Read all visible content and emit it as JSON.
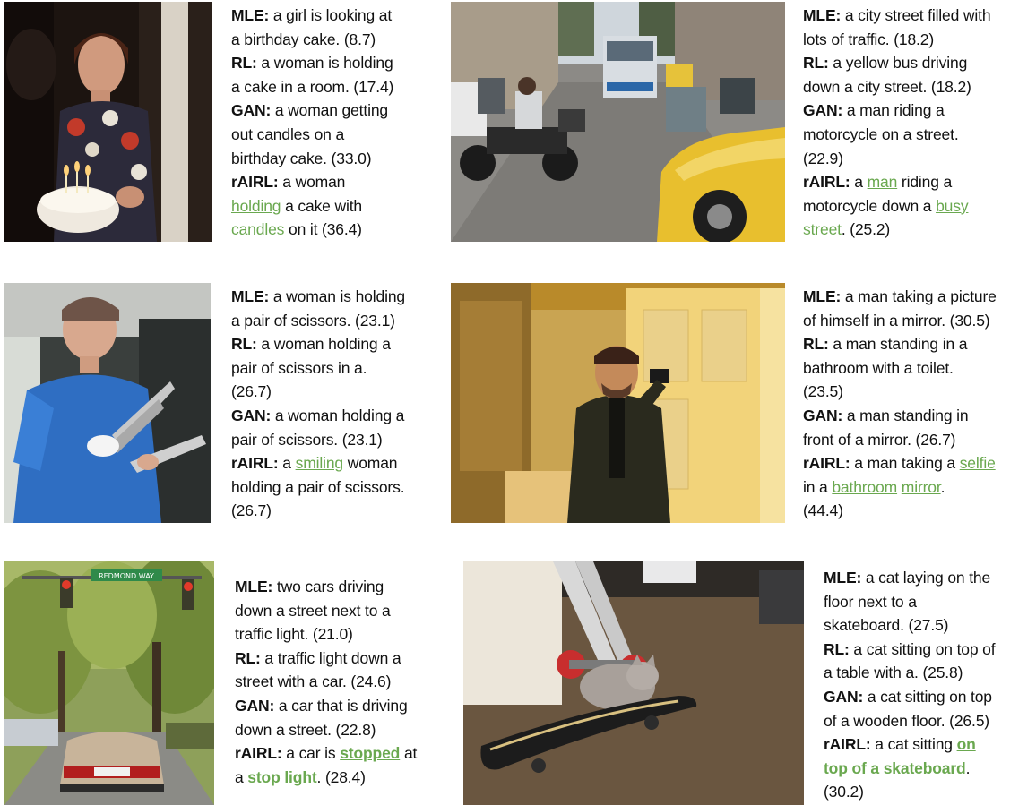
{
  "figures": [
    {
      "image": "woman-birthday-cake-photo",
      "lines": [
        [
          {
            "t": "MLE:",
            "s": "b"
          },
          {
            "t": " a girl is looking at"
          }
        ],
        [
          {
            "t": "a birthday cake. (8.7)"
          }
        ],
        [
          {
            "t": "RL:",
            "s": "b"
          },
          {
            "t": " a woman is holding"
          }
        ],
        [
          {
            "t": "a cake in a room. (17.4)"
          }
        ],
        [
          {
            "t": "GAN:",
            "s": "b"
          },
          {
            "t": " a woman getting"
          }
        ],
        [
          {
            "t": "out candles on a"
          }
        ],
        [
          {
            "t": "birthday cake. (33.0)"
          }
        ],
        [
          {
            "t": "rAIRL:",
            "s": "b"
          },
          {
            "t": " a woman"
          }
        ],
        [
          {
            "t": "holding",
            "s": "h"
          },
          {
            "t": " a cake with"
          }
        ],
        [
          {
            "t": "candles",
            "s": "h"
          },
          {
            "t": " on it (36.4)"
          }
        ]
      ]
    },
    {
      "image": "city-street-traffic-motorcycle-photo",
      "lines": [
        [
          {
            "t": "MLE:",
            "s": "b"
          },
          {
            "t": " a city street filled with"
          }
        ],
        [
          {
            "t": "lots of traffic. (18.2)"
          }
        ],
        [
          {
            "t": "RL:",
            "s": "b"
          },
          {
            "t": " a yellow bus driving"
          }
        ],
        [
          {
            "t": "down a city street. (18.2)"
          }
        ],
        [
          {
            "t": "GAN:",
            "s": "b"
          },
          {
            "t": " a man riding a"
          }
        ],
        [
          {
            "t": "motorcycle on a street."
          }
        ],
        [
          {
            "t": "(22.9)"
          }
        ],
        [
          {
            "t": "rAIRL:",
            "s": "b"
          },
          {
            "t": " a "
          },
          {
            "t": "man",
            "s": "h"
          },
          {
            "t": " riding a"
          }
        ],
        [
          {
            "t": "motorcycle down a "
          },
          {
            "t": "busy",
            "s": "h"
          }
        ],
        [
          {
            "t": "street",
            "s": "h"
          },
          {
            "t": ". (25.2)"
          }
        ]
      ]
    },
    {
      "image": "woman-holding-scissors-photo",
      "lines": [
        [
          {
            "t": "MLE:",
            "s": "b"
          },
          {
            "t": " a woman is holding"
          }
        ],
        [
          {
            "t": "a pair of scissors. (23.1)"
          }
        ],
        [
          {
            "t": "RL:",
            "s": "b"
          },
          {
            "t": " a woman holding a"
          }
        ],
        [
          {
            "t": "pair of scissors in a."
          }
        ],
        [
          {
            "t": "(26.7)"
          }
        ],
        [
          {
            "t": "GAN:",
            "s": "b"
          },
          {
            "t": " a woman holding a"
          }
        ],
        [
          {
            "t": "pair of scissors. (23.1)"
          }
        ],
        [
          {
            "t": "rAIRL:",
            "s": "b"
          },
          {
            "t": " a "
          },
          {
            "t": "smiling",
            "s": "h"
          },
          {
            "t": " woman"
          }
        ],
        [
          {
            "t": "holding a pair of scissors."
          }
        ],
        [
          {
            "t": "(26.7)"
          }
        ]
      ]
    },
    {
      "image": "man-bathroom-mirror-selfie-photo",
      "lines": [
        [
          {
            "t": "MLE:",
            "s": "b"
          },
          {
            "t": " a man taking a picture"
          }
        ],
        [
          {
            "t": "of himself in a mirror. (30.5)"
          }
        ],
        [
          {
            "t": "RL:",
            "s": "b"
          },
          {
            "t": " a man standing in a"
          }
        ],
        [
          {
            "t": "bathroom with a toilet."
          }
        ],
        [
          {
            "t": "(23.5)"
          }
        ],
        [
          {
            "t": "GAN:",
            "s": "b"
          },
          {
            "t": " a man standing in"
          }
        ],
        [
          {
            "t": "front of a mirror. (26.7)"
          }
        ],
        [
          {
            "t": "rAIRL:",
            "s": "b"
          },
          {
            "t": " a man taking a "
          },
          {
            "t": "selfie",
            "s": "h"
          }
        ],
        [
          {
            "t": "in a "
          },
          {
            "t": "bathroom",
            "s": "h"
          },
          {
            "t": " "
          },
          {
            "t": "mirror",
            "s": "h"
          },
          {
            "t": "."
          }
        ],
        [
          {
            "t": "(44.4)"
          }
        ]
      ]
    },
    {
      "image": "car-at-traffic-light-photo",
      "street_sign": "REDMOND WAY",
      "lines": [
        [
          {
            "t": "MLE:",
            "s": "b"
          },
          {
            "t": " two cars driving"
          }
        ],
        [
          {
            "t": "down a street next to a"
          }
        ],
        [
          {
            "t": "traffic light. (21.0)"
          }
        ],
        [
          {
            "t": "RL:",
            "s": "b"
          },
          {
            "t": " a traffic light down a"
          }
        ],
        [
          {
            "t": "street with a car. (24.6)"
          }
        ],
        [
          {
            "t": "GAN:",
            "s": "b"
          },
          {
            "t": " a car that is driving"
          }
        ],
        [
          {
            "t": "down a street. (22.8)"
          }
        ],
        [
          {
            "t": "rAIRL:",
            "s": "b"
          },
          {
            "t": " a car is "
          },
          {
            "t": "stopped",
            "s": "hb"
          },
          {
            "t": " at"
          }
        ],
        [
          {
            "t": "a "
          },
          {
            "t": "stop light",
            "s": "hb"
          },
          {
            "t": ". (28.4)"
          }
        ]
      ]
    },
    {
      "image": "cat-on-skateboard-photo",
      "lines": [
        [
          {
            "t": "MLE:",
            "s": "b"
          },
          {
            "t": " a cat laying on the"
          }
        ],
        [
          {
            "t": "floor next to a"
          }
        ],
        [
          {
            "t": "skateboard. (27.5)"
          }
        ],
        [
          {
            "t": "RL:",
            "s": "b"
          },
          {
            "t": " a cat sitting on top of"
          }
        ],
        [
          {
            "t": "a table with a. (25.8)"
          }
        ],
        [
          {
            "t": "GAN:",
            "s": "b"
          },
          {
            "t": " a cat sitting on top"
          }
        ],
        [
          {
            "t": "of a wooden floor. (26.5)"
          }
        ],
        [
          {
            "t": "rAIRL:",
            "s": "b"
          },
          {
            "t": " a cat sitting "
          },
          {
            "t": "on",
            "s": "hb"
          }
        ],
        [
          {
            "t": "top of a skateboard",
            "s": "hb"
          },
          {
            "t": "."
          }
        ],
        [
          {
            "t": "(30.2)"
          }
        ]
      ]
    }
  ],
  "colors": {
    "highlight": "#6aa84f",
    "text": "#111111"
  }
}
